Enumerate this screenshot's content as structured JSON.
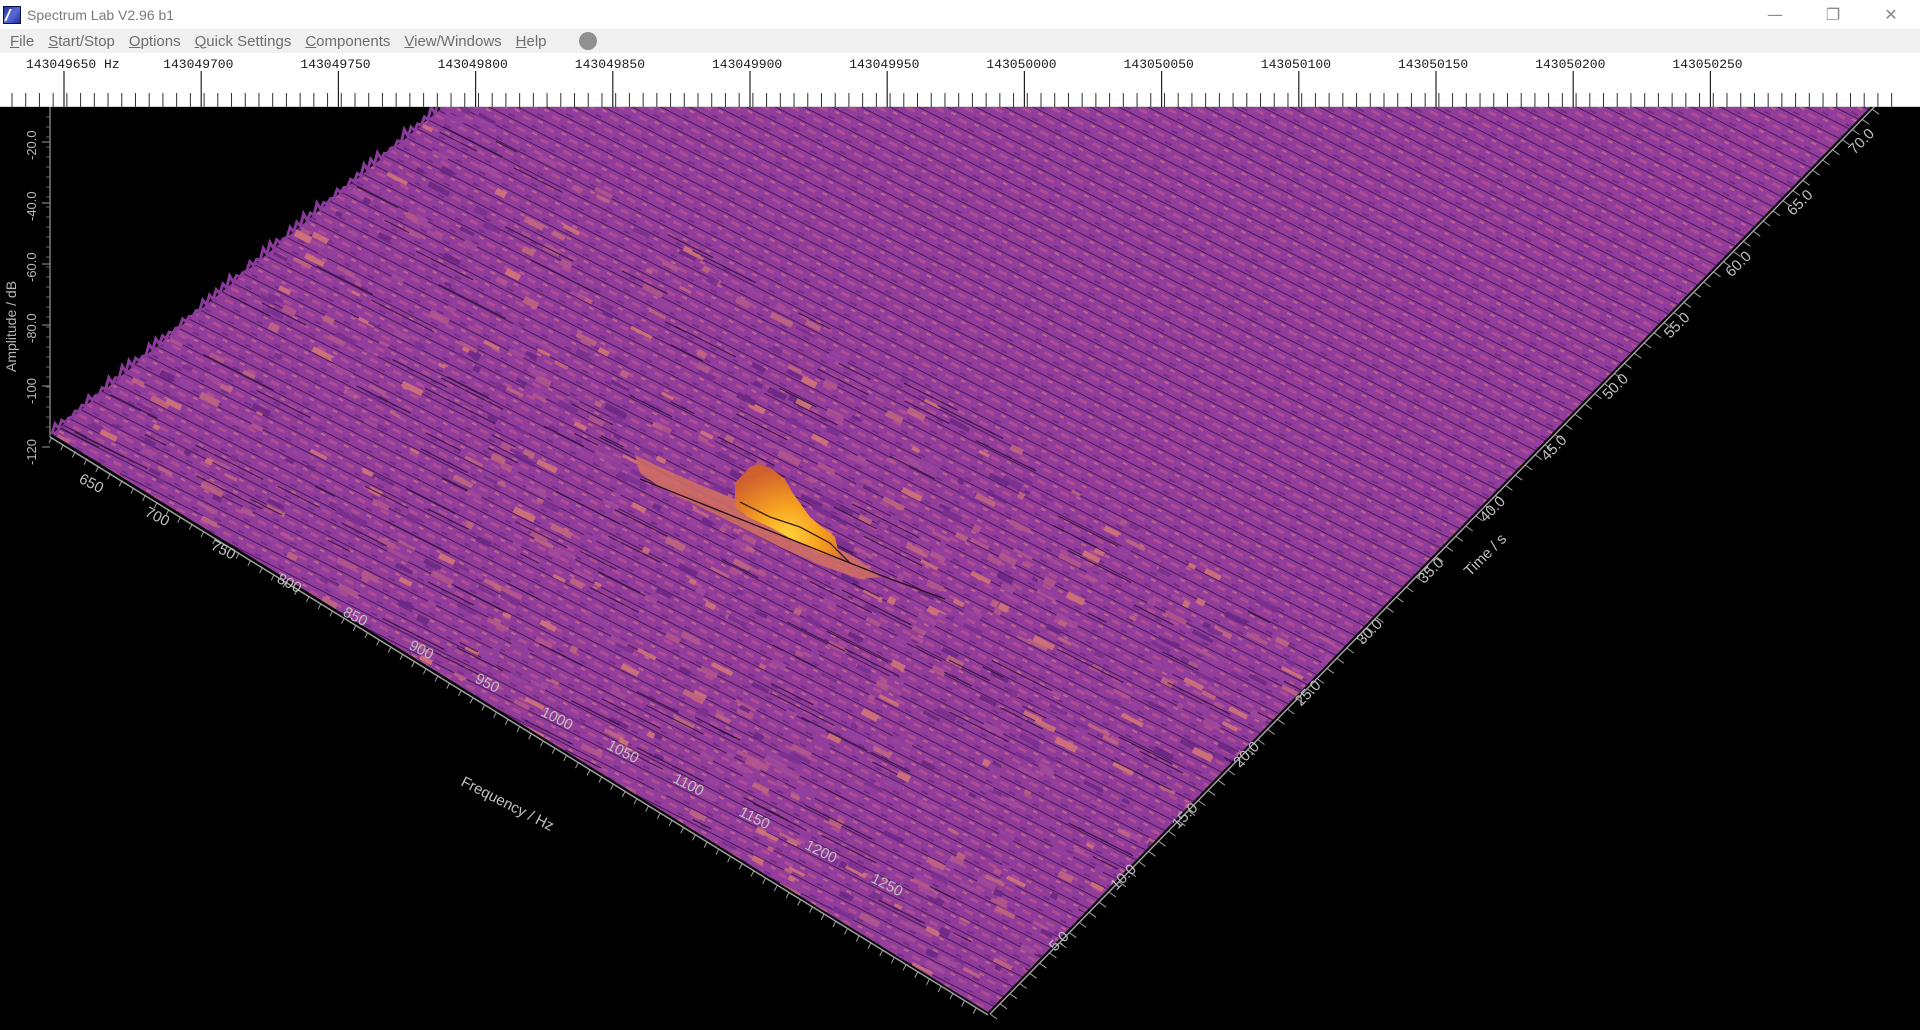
{
  "window": {
    "title": "Spectrum Lab V2.96 b1",
    "minimize_glyph": "—",
    "maximize_glyph": "❐",
    "close_glyph": "✕"
  },
  "menu": {
    "items": [
      {
        "label": "File",
        "accel": "F",
        "rest": "ile"
      },
      {
        "label": "Start/Stop",
        "accel": "S",
        "rest": "tart/Stop"
      },
      {
        "label": "Options",
        "accel": "O",
        "rest": "ptions"
      },
      {
        "label": "Quick Settings",
        "accel": "Q",
        "rest": "uick Settings"
      },
      {
        "label": "Components",
        "accel": "C",
        "rest": "omponents"
      },
      {
        "label": "View/Windows",
        "accel": "V",
        "rest": "iew/Windows"
      },
      {
        "label": "Help",
        "accel": "H",
        "rest": "elp"
      }
    ],
    "record_icon": "record-dot-icon"
  },
  "frequency_scale": {
    "labels": [
      "143049650 Hz",
      "143049700",
      "143049750",
      "143049800",
      "143049850",
      "143049900",
      "143049950",
      "143050000",
      "143050050",
      "143050100",
      "143050150",
      "143050200",
      "143050250"
    ]
  },
  "chart_data": {
    "type": "3d-waterfall",
    "amplitude_axis": {
      "label": "Amplitude / dB",
      "ticks": [
        "-20.0",
        "-40.0",
        "-60.0",
        "-80.0",
        "-100",
        "-120"
      ]
    },
    "frequency_axis": {
      "label": "Frequency / Hz",
      "ticks": [
        "650",
        "700",
        "750",
        "800",
        "850",
        "900",
        "950",
        "1000",
        "1050",
        "1100",
        "1150",
        "1200",
        "1250"
      ]
    },
    "time_axis": {
      "label": "Time / s",
      "ticks": [
        "5.0",
        "10.0",
        "15.0",
        "20.0",
        "25.0",
        "30.0",
        "35.0",
        "40.0",
        "45.0",
        "50.0",
        "55.0",
        "60.0",
        "65.0",
        "70.0"
      ]
    },
    "colors": {
      "noise_floor": "#8a3a9a",
      "noise_highlight": "#c76a8a",
      "peak_low": "#e07a3a",
      "peak_high": "#ffc21a",
      "background": "#000000"
    }
  }
}
